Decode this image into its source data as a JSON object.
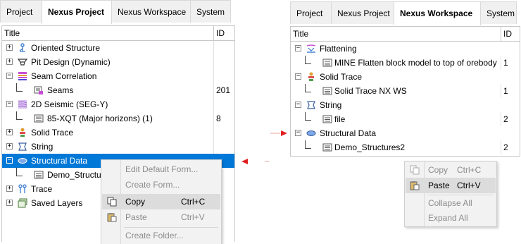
{
  "left": {
    "tabs": [
      "Project",
      "Nexus Project",
      "Nexus Workspace",
      "System"
    ],
    "active_tab": "Nexus Project",
    "columns": {
      "title": "Title",
      "id": "ID"
    },
    "rows": [
      {
        "label": "Oriented Structure",
        "id": "",
        "icon": "oriented-structure-icon",
        "expander": "+"
      },
      {
        "label": "Pit Design (Dynamic)",
        "id": "",
        "icon": "pit-design-icon",
        "expander": "+"
      },
      {
        "label": "Seam Correlation",
        "id": "",
        "icon": "seam-correlation-icon",
        "expander": "−"
      },
      {
        "label": "Seams",
        "id": "201",
        "icon": "seams-icon",
        "expander": ""
      },
      {
        "label": "2D Seismic (SEG-Y)",
        "id": "",
        "icon": "seismic-icon",
        "expander": "−"
      },
      {
        "label": "85-XQT (Major horizons) (1)",
        "id": "8",
        "icon": "table-icon",
        "expander": ""
      },
      {
        "label": "Solid Trace",
        "id": "",
        "icon": "solid-trace-icon",
        "expander": "+"
      },
      {
        "label": "String",
        "id": "",
        "icon": "string-icon",
        "expander": "+"
      },
      {
        "label": "Structural Data",
        "id": "",
        "icon": "structural-data-icon",
        "expander": "−"
      },
      {
        "label": "Demo_Structur",
        "id": "",
        "icon": "table-icon",
        "expander": ""
      },
      {
        "label": "Trace",
        "id": "",
        "icon": "trace-icon",
        "expander": "+"
      },
      {
        "label": "Saved Layers",
        "id": "",
        "icon": "saved-layers-icon",
        "expander": "+"
      }
    ],
    "context_menu": {
      "items": [
        {
          "label": "Edit Default Form...",
          "shortcut": "",
          "disabled": true
        },
        {
          "label": "Create Form...",
          "shortcut": "",
          "disabled": true
        },
        {
          "label": "Copy",
          "shortcut": "Ctrl+C",
          "disabled": false,
          "icon": "copy-icon"
        },
        {
          "label": "Paste",
          "shortcut": "Ctrl+V",
          "disabled": true,
          "icon": "paste-icon"
        },
        {
          "label": "Create Folder...",
          "shortcut": "",
          "disabled": true
        }
      ]
    }
  },
  "right": {
    "tabs": [
      "Project",
      "Nexus Project",
      "Nexus Workspace",
      "System"
    ],
    "active_tab": "Nexus Workspace",
    "columns": {
      "title": "Title",
      "id": "ID"
    },
    "rows": [
      {
        "label": "Flattening",
        "id": "",
        "icon": "flattening-icon",
        "expander": "−"
      },
      {
        "label": "MINE Flatten block model to top of orebody",
        "id": "1",
        "icon": "table-icon",
        "expander": ""
      },
      {
        "label": "Solid Trace",
        "id": "",
        "icon": "solid-trace-icon",
        "expander": "−"
      },
      {
        "label": "Solid Trace NX WS",
        "id": "1",
        "icon": "table-icon",
        "expander": ""
      },
      {
        "label": "String",
        "id": "",
        "icon": "string-icon",
        "expander": "−"
      },
      {
        "label": "file",
        "id": "2",
        "icon": "table-icon",
        "expander": ""
      },
      {
        "label": "Structural Data",
        "id": "",
        "icon": "structural-data-icon",
        "expander": "−"
      },
      {
        "label": "Demo_Structures2",
        "id": "2",
        "icon": "table-icon",
        "expander": ""
      }
    ],
    "context_menu": {
      "items": [
        {
          "label": "Copy",
          "shortcut": "Ctrl+C",
          "disabled": true,
          "icon": "copy-icon"
        },
        {
          "label": "Paste",
          "shortcut": "Ctrl+V",
          "disabled": false,
          "icon": "paste-icon"
        },
        {
          "label": "Collapse All",
          "shortcut": "",
          "disabled": true
        },
        {
          "label": "Expand All",
          "shortcut": "",
          "disabled": true
        }
      ]
    }
  },
  "colors": {
    "selection": "#0078d7",
    "arrow": "#e02020"
  }
}
